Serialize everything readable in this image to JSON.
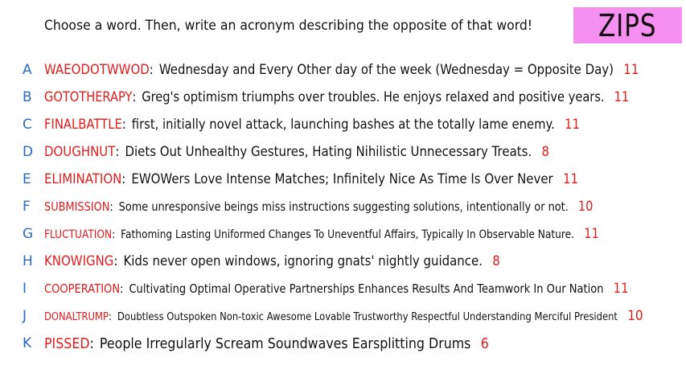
{
  "header": {
    "prompt": "Choose a word. Then, write an acronym describing the opposite of that word!",
    "badge": "ZIPS"
  },
  "colors": {
    "letter": "#2a6bbf",
    "word": "#e21c1c",
    "score": "#e21c1c",
    "badge_bg": "#f58ff0"
  },
  "entries": [
    {
      "letter": "A",
      "word": "WAEODOTWWOD",
      "definition": "Wednesday and Every Other day of the week (Wednesday = Opposite Day)",
      "score": "11"
    },
    {
      "letter": "B",
      "word": "GOTOTHERAPY",
      "definition": "Greg's optimism triumphs over troubles. He enjoys relaxed and positive years.",
      "score": "11"
    },
    {
      "letter": "C",
      "word": "FINALBATTLE",
      "definition": "first, initially novel attack, launching bashes at the totally lame enemy.",
      "score": "11"
    },
    {
      "letter": "D",
      "word": "DOUGHNUT",
      "definition": "Diets Out Unhealthy Gestures, Hating Nihilistic Unnecessary Treats.",
      "score": "8"
    },
    {
      "letter": "E",
      "word": "ELIMINATION",
      "definition": "EWOWers Love Intense Matches; Infinitely Nice As Time Is Over Never",
      "score": "11"
    },
    {
      "letter": "F",
      "word": "SUBMISSION",
      "definition": "Some unresponsive beings miss instructions suggesting solutions, intentionally or not.",
      "score": "10"
    },
    {
      "letter": "G",
      "word": "FLUCTUATION",
      "definition": "Fathoming Lasting Uniformed Changes To Uneventful Affairs, Typically In Observable Nature.",
      "score": "11"
    },
    {
      "letter": "H",
      "word": "KNOWIGNG",
      "definition": "Kids never open windows, ignoring gnats' nightly guidance.",
      "score": "8"
    },
    {
      "letter": "I",
      "word": "COOPERATION",
      "definition": "Cultivating Optimal Operative Partnerships Enhances Results And Teamwork In Our Nation",
      "score": "11"
    },
    {
      "letter": "J",
      "word": "DONALTRUMP",
      "definition": "Doubtless Outspoken Non-toxic Awesome Lovable Trustworthy Respectful Understanding Merciful President",
      "score": "10"
    },
    {
      "letter": "K",
      "word": "PISSED",
      "definition": "People Irregularly Scream Soundwaves Earsplitting Drums",
      "score": "6"
    }
  ]
}
